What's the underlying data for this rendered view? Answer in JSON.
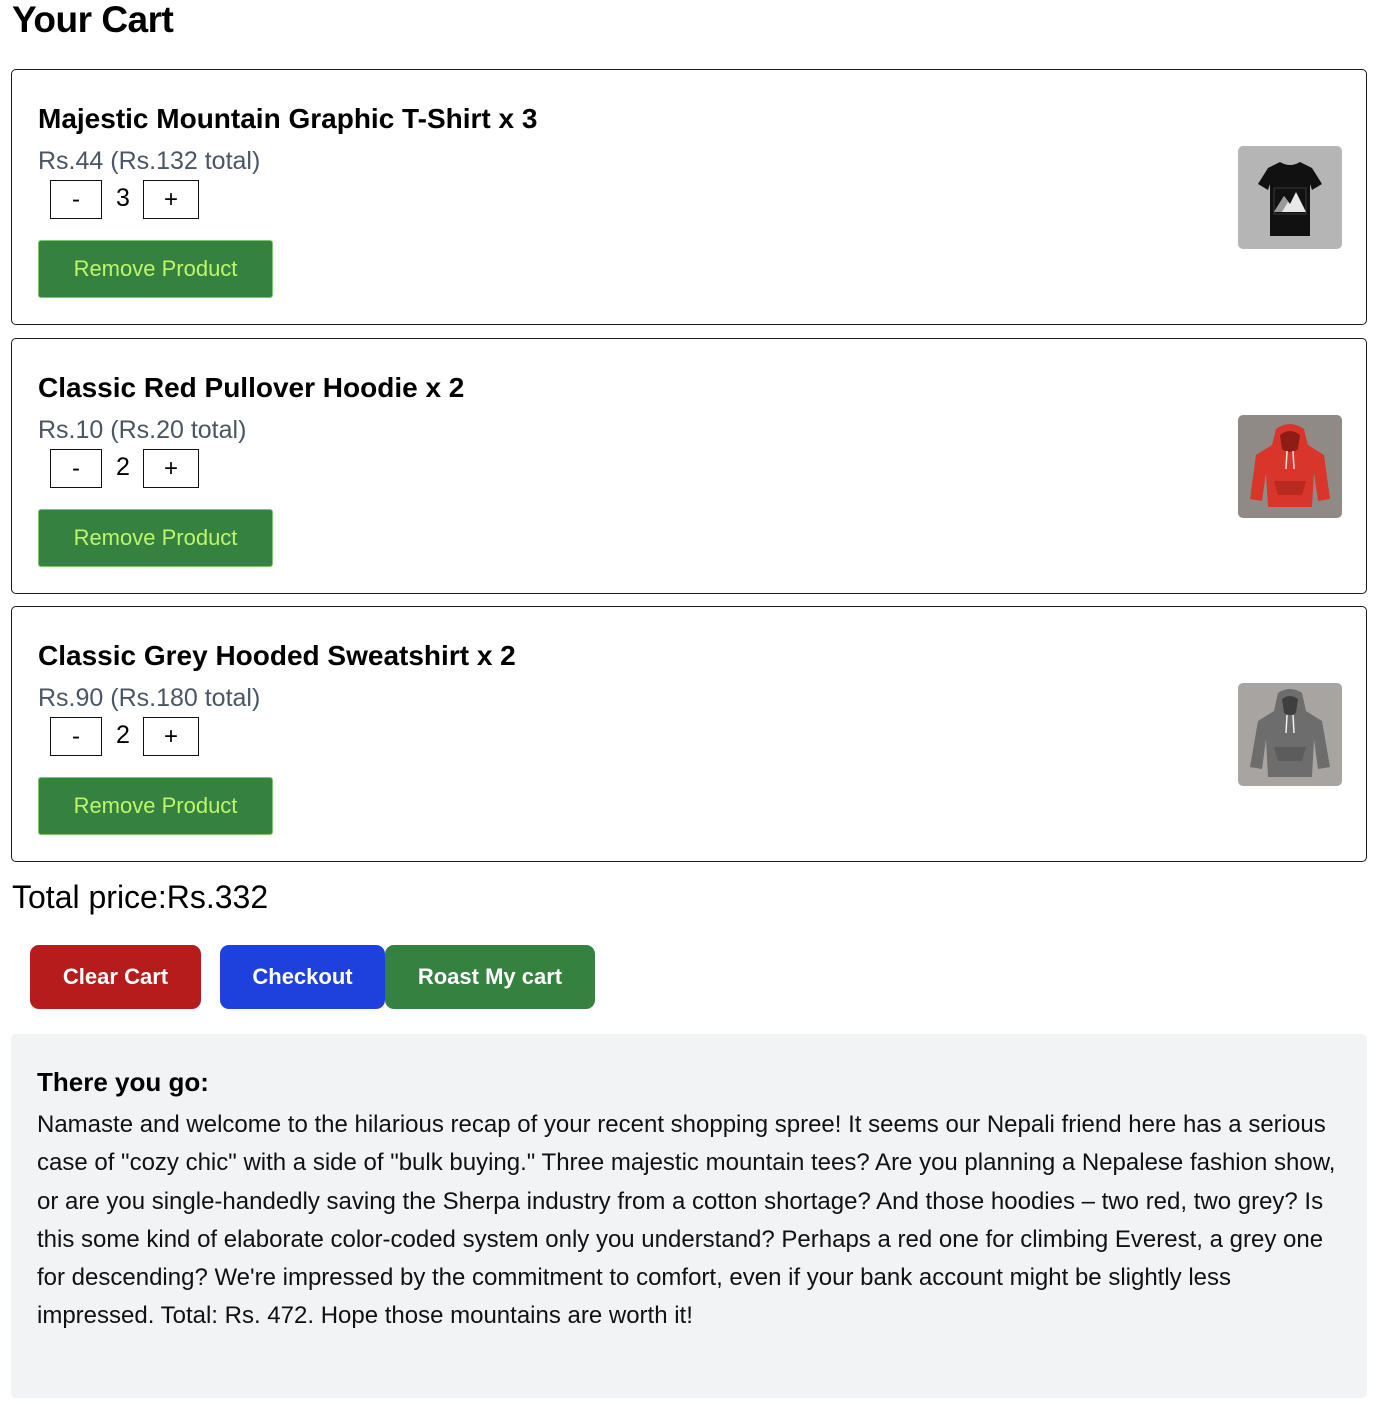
{
  "page": {
    "title": "Your Cart"
  },
  "cart": {
    "items": [
      {
        "name": "Majestic Mountain Graphic T-Shirt x 3",
        "price": "Rs.44 (Rs.132 total)",
        "quantity": "3",
        "minus_label": "-",
        "plus_label": "+",
        "remove_label": "Remove Product",
        "image_icon": "black-mountain-tshirt-icon"
      },
      {
        "name": "Classic Red Pullover Hoodie x 2",
        "price": "Rs.10 (Rs.20 total)",
        "quantity": "2",
        "minus_label": "-",
        "plus_label": "+",
        "remove_label": "Remove Product",
        "image_icon": "red-hoodie-icon"
      },
      {
        "name": "Classic Grey Hooded Sweatshirt x 2",
        "price": "Rs.90 (Rs.180 total)",
        "quantity": "2",
        "minus_label": "-",
        "plus_label": "+",
        "remove_label": "Remove Product",
        "image_icon": "grey-hoodie-icon"
      }
    ],
    "total": "Total price:Rs.332"
  },
  "actions": {
    "clear_label": "Clear Cart",
    "checkout_label": "Checkout",
    "roast_label": "Roast My cart"
  },
  "roast": {
    "heading": "There you go:",
    "text": "Namaste and welcome to the hilarious recap of your recent shopping spree! It seems our Nepali friend here has a serious case of \"cozy chic\" with a side of \"bulk buying.\" Three majestic mountain tees? Are you planning a Nepalese fashion show, or are you single-handedly saving the Sherpa industry from a cotton shortage? And those hoodies – two red, two grey? Is this some kind of elaborate color-coded system only you understand? Perhaps a red one for climbing Everest, a grey one for descending? We're impressed by the commitment to comfort, even if your bank account might be slightly less impressed. Total: Rs. 472. Hope those mountains are worth it!"
  },
  "colors": {
    "remove_button": "#35813f",
    "remove_text": "#bff56b",
    "clear_button": "#b71c1c",
    "checkout_button": "#1e40dc",
    "roast_button": "#35813f",
    "roast_panel": "#f2f3f5",
    "price_text": "#4b5563"
  }
}
